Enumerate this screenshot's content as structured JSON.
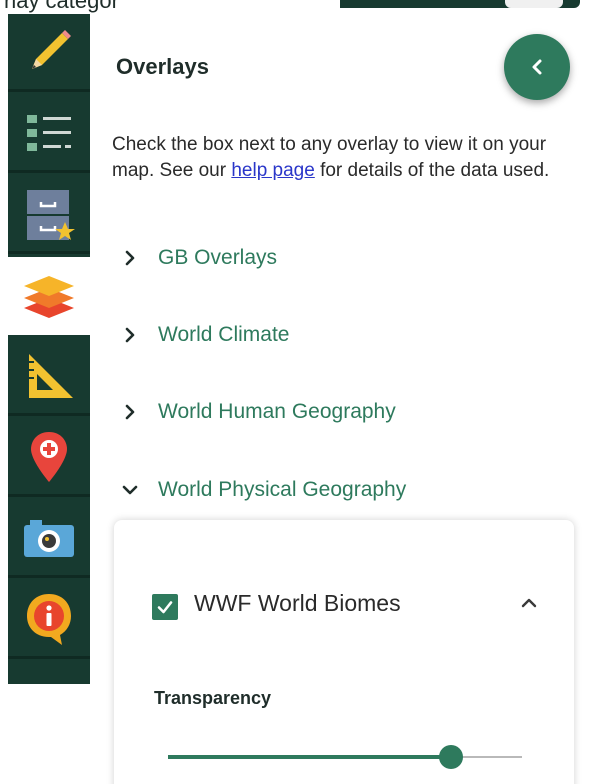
{
  "top_strip": {
    "cropped_text": "rlay categor"
  },
  "rail": {
    "items": [
      {
        "name": "pencil",
        "icon": "pencil-icon",
        "active": false
      },
      {
        "name": "legend",
        "icon": "list-icon",
        "active": false
      },
      {
        "name": "saved-maps",
        "icon": "cabinet-star-icon",
        "active": false
      },
      {
        "name": "overlays",
        "icon": "layers-icon",
        "active": true
      },
      {
        "name": "measure",
        "icon": "set-square-icon",
        "active": false
      },
      {
        "name": "add-marker",
        "icon": "map-pin-plus-icon",
        "active": false
      },
      {
        "name": "snapshot",
        "icon": "camera-icon",
        "active": false
      },
      {
        "name": "info",
        "icon": "info-icon",
        "active": false
      }
    ]
  },
  "panel": {
    "title": "Overlays",
    "collapse_icon": "chevron-left-icon",
    "intro_before": "Check the box next to any overlay to view it on your map. See our ",
    "intro_link": "help page",
    "intro_after": " for details of the data used.",
    "sections": [
      {
        "label": "GB Overlays",
        "expanded": false
      },
      {
        "label": "World Climate",
        "expanded": false
      },
      {
        "label": "World Human Geography",
        "expanded": false
      },
      {
        "label": "World Physical Geography",
        "expanded": true
      }
    ],
    "layer": {
      "name": "WWF World Biomes",
      "checked": true,
      "transparency_label": "Transparency",
      "transparency_value": 0.8
    }
  },
  "colors": {
    "rail_bg": "#173a30",
    "accent": "#2e7a5d",
    "link": "#2a36c9"
  }
}
